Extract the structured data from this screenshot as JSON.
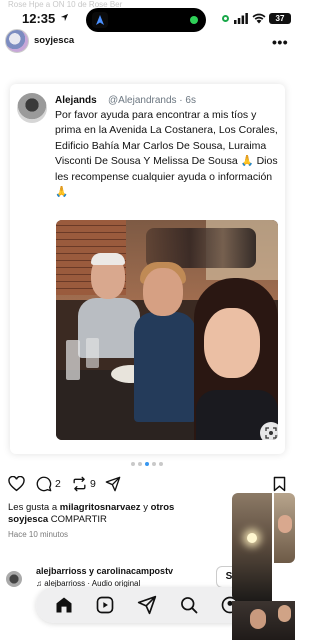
{
  "status_bar": {
    "ghost_text": "Rose Hpe a ON 10 de Rose Ber",
    "time": "12:35",
    "battery": "37"
  },
  "header": {
    "username": "soyjesca",
    "more": "•••"
  },
  "tweet": {
    "display_name": "Alejands",
    "handle_time": "@Alejandrands · 6s",
    "text": "Por favor ayuda para encontrar a mis tíos y prima en la Avenida La Costanera, Los Corales, Edificio Bahía Mar Carlos De Sousa, Luraima Visconti De Sousa Y Melissa De Sousa 🙏 Dios les recompense cualquier ayuda o información 🙏"
  },
  "carousel": {
    "total": 5,
    "active": 2
  },
  "actions": {
    "comments": "2",
    "reposts": "9"
  },
  "likes": {
    "prefix": "Les gusta a ",
    "user": "milagritosnarvaez",
    "middle": " y ",
    "others": "otros"
  },
  "caption": {
    "user": "soyjesca",
    "text": " COMPARTIR"
  },
  "time_ago": "Hace 10 minutos",
  "next_post": {
    "users": "alejbarrioss y carolinacampostv",
    "audio": "♫ alejbarrioss · Audio original",
    "button": "S"
  },
  "tabbar": {
    "icons": [
      "home-icon",
      "reels-icon",
      "send-icon",
      "search-icon",
      "profile-icon"
    ]
  },
  "colors": {
    "island_dot": "#2fd158",
    "text": "#111111",
    "muted": "#6b7680"
  }
}
